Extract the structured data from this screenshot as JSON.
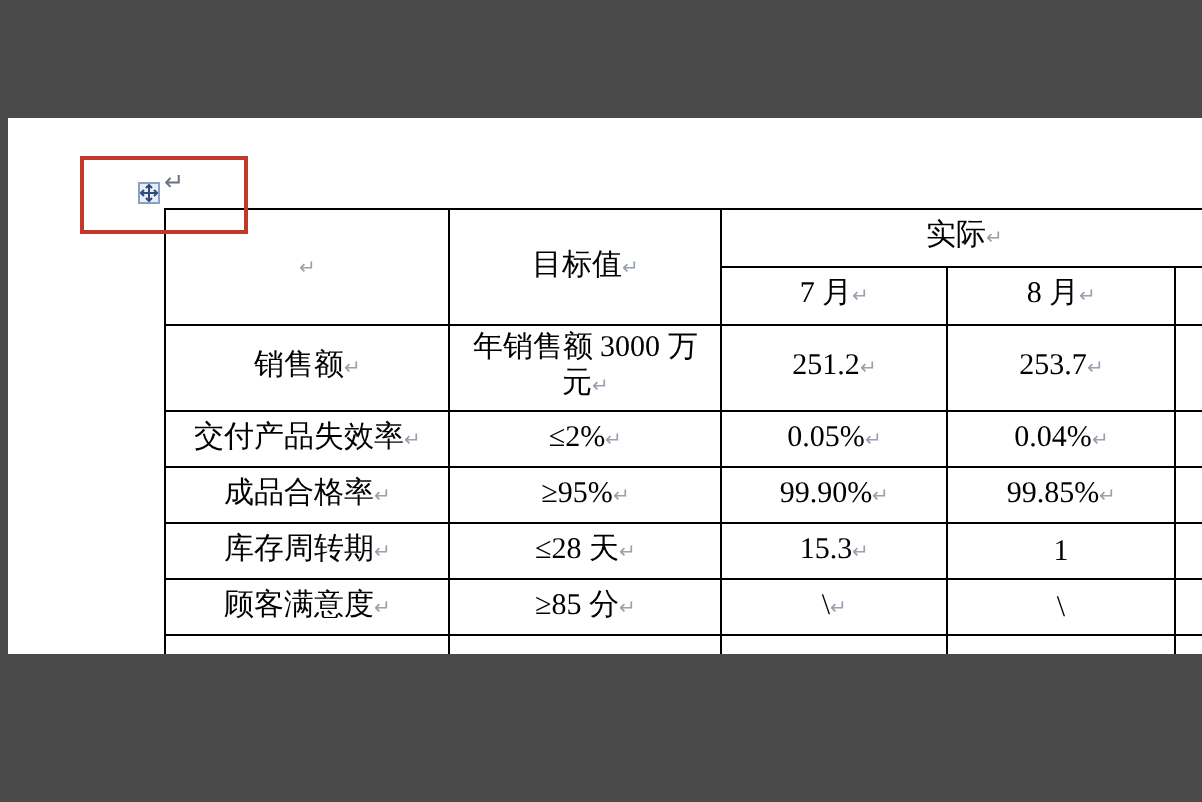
{
  "handle_mark": "↵",
  "table": {
    "header": {
      "corner": {
        "mark": "↵"
      },
      "target": {
        "text": "目标值",
        "mark": "↵"
      },
      "actual": {
        "text": "实际",
        "mark": "↵"
      },
      "months": [
        {
          "text": "7 月",
          "mark": "↵"
        },
        {
          "text": "8 月",
          "mark": "↵"
        }
      ]
    },
    "rows": [
      {
        "cells": [
          {
            "text": "销售额",
            "mark": "↵"
          },
          {
            "text": "年销售额 3000 万元",
            "mark": "↵"
          },
          {
            "text": "251.2",
            "mark": "↵"
          },
          {
            "text": "253.7",
            "mark": "↵"
          }
        ]
      },
      {
        "cells": [
          {
            "text": "交付产品失效率",
            "mark": "↵"
          },
          {
            "text": "≤2%",
            "mark": "↵"
          },
          {
            "text": "0.05%",
            "mark": "↵"
          },
          {
            "text": "0.04%",
            "mark": "↵"
          }
        ]
      },
      {
        "cells": [
          {
            "text": "成品合格率",
            "mark": "↵"
          },
          {
            "text": "≥95%",
            "mark": "↵"
          },
          {
            "text": "99.90%",
            "mark": "↵"
          },
          {
            "text": "99.85%",
            "mark": "↵"
          }
        ]
      },
      {
        "cells": [
          {
            "text": "库存周转期",
            "mark": "↵"
          },
          {
            "text": "≤28 天",
            "mark": "↵"
          },
          {
            "text": "15.3",
            "mark": "↵"
          },
          {
            "text": "1"
          }
        ]
      },
      {
        "cells": [
          {
            "text": "顾客满意度",
            "mark": "↵"
          },
          {
            "text": "≥85 分",
            "mark": "↵"
          },
          {
            "text": "\\",
            "mark": "↵"
          },
          {
            "text": "\\"
          }
        ]
      }
    ]
  }
}
